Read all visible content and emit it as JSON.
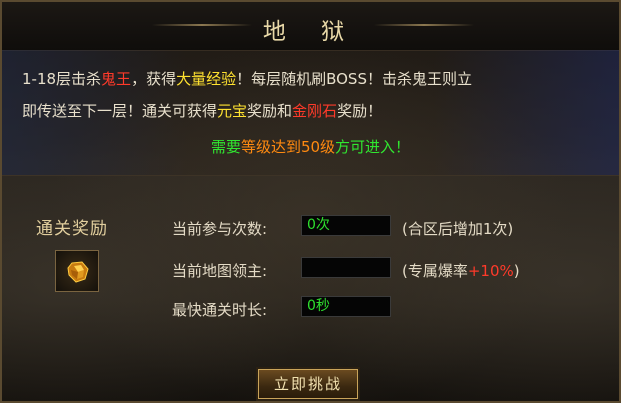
{
  "title": "地 狱",
  "description": {
    "line1": [
      {
        "text": "1-18层击杀",
        "color": "white"
      },
      {
        "text": "鬼王",
        "color": "red"
      },
      {
        "text": "，获得",
        "color": "white"
      },
      {
        "text": "大量经验",
        "color": "yellow"
      },
      {
        "text": "！每层随机刷BOSS！击杀鬼王则立",
        "color": "white"
      }
    ],
    "line2": [
      {
        "text": "即传送至下一层！通关可获得",
        "color": "white"
      },
      {
        "text": "元宝",
        "color": "yellow"
      },
      {
        "text": "奖励和",
        "color": "white"
      },
      {
        "text": "金刚石",
        "color": "red"
      },
      {
        "text": "奖励！",
        "color": "white"
      }
    ],
    "line3": [
      {
        "text": "需要",
        "color": "green"
      },
      {
        "text": "等级达到50级",
        "color": "orange"
      },
      {
        "text": "方可进入！",
        "color": "green"
      }
    ]
  },
  "reward": {
    "label": "通关奖励",
    "item_icon": "gold-ore-icon"
  },
  "stats": {
    "attempts_label": "当前参与次数:",
    "attempts_value": "0次",
    "attempts_note": "(合区后增加1次)",
    "lord_label": "当前地图领主:",
    "lord_value": "",
    "lord_note_prefix": "(专属爆率",
    "lord_note_bonus": "+10%",
    "lord_note_suffix": ")",
    "fastest_label": "最快通关时长:",
    "fastest_value": "0秒"
  },
  "buttons": {
    "challenge": "立即挑战"
  },
  "colors": {
    "red": "#ff3a2a",
    "yellow": "#ffe230",
    "orange": "#ff8a10",
    "green": "#30e830",
    "value_green": "#2ee02e"
  }
}
